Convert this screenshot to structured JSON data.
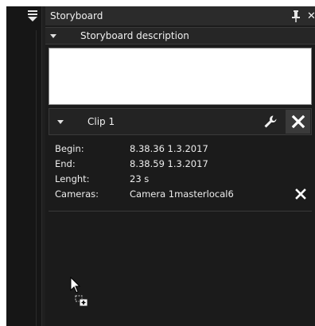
{
  "panel": {
    "title": "Storyboard",
    "description_header": "Storyboard description",
    "description_value": ""
  },
  "clip": {
    "label": "Clip 1",
    "fields": [
      {
        "key": "Begin:",
        "value": "8.38.36 1.3.2017"
      },
      {
        "key": "End:",
        "value": "8.38.59 1.3.2017"
      },
      {
        "key": "Lenght:",
        "value": "23 s"
      },
      {
        "key": "Cameras:",
        "value": "Camera 1masterlocal6"
      }
    ]
  },
  "icons": {
    "menu": "menu-lines-icon",
    "pin": "pin-icon",
    "close": "close-icon",
    "wrench": "wrench-icon",
    "remove": "close-icon",
    "cursor": "drag-copy-cursor-icon"
  },
  "colors": {
    "background": "#1b1b1b",
    "titlebar": "#2b2b2b",
    "text": "#f0f0f0"
  }
}
